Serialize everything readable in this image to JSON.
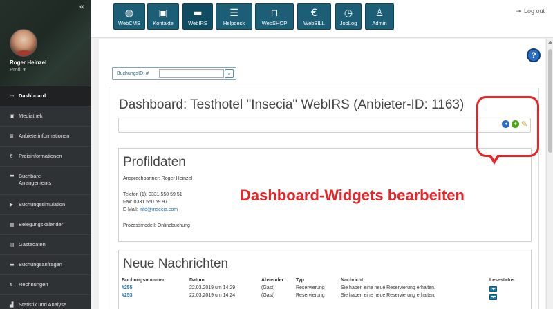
{
  "sidebar": {
    "collapse_icon": "double-chevron-left-icon",
    "user_name": "Roger Heinzel",
    "profile_label": "Profil ▾",
    "items": [
      {
        "label": "Dashboard",
        "icon": "monitor-icon",
        "glyph": "▭"
      },
      {
        "label": "Mediathek",
        "icon": "image-icon",
        "glyph": "▣"
      },
      {
        "label": "Anbieterinformationen",
        "icon": "list-icon",
        "glyph": "≣"
      },
      {
        "label": "Preisinformationen",
        "icon": "euro-icon",
        "glyph": "€"
      },
      {
        "label": "Buchbare Arrangements",
        "icon": "bed-icon",
        "glyph": "▬"
      },
      {
        "label": "Buchungssimulation",
        "icon": "play-icon",
        "glyph": "▶"
      },
      {
        "label": "Belegungskalender",
        "icon": "calendar-icon",
        "glyph": "▦"
      },
      {
        "label": "Gästedaten",
        "icon": "user-card-icon",
        "glyph": "▤"
      },
      {
        "label": "Buchungsanfragen",
        "icon": "bed-icon",
        "glyph": "▬"
      },
      {
        "label": "Rechnungen",
        "icon": "euro-icon",
        "glyph": "€"
      },
      {
        "label": "Statistik und Analyse",
        "icon": "chart-icon",
        "glyph": "▟"
      }
    ]
  },
  "nav": [
    {
      "label": "WebCMS",
      "glyph": "◍"
    },
    {
      "label": "Kontakte",
      "glyph": "▣"
    },
    {
      "label": "WebIRS",
      "glyph": "▬"
    },
    {
      "label": "Helpdesk",
      "glyph": "☰"
    },
    {
      "label": "WebSHOP",
      "glyph": "⊓"
    },
    {
      "label": "WebBILL",
      "glyph": "€"
    },
    {
      "label": "JobLog",
      "glyph": "◷"
    },
    {
      "label": "Admin",
      "glyph": "♙"
    }
  ],
  "header": {
    "logout_label": "Log out",
    "help_label": "?"
  },
  "search": {
    "label": "BuchungsID: #",
    "value": ""
  },
  "dashboard": {
    "title": "Dashboard: Testhotel \"Insecia\" WebIRS (Anbieter-ID: 1163)"
  },
  "annotation": "Dashboard-Widgets bearbeiten",
  "profil": {
    "title": "Profildaten",
    "contact": "Ansprechpartner: Roger Heinzel",
    "phone": "Telefon (1): 0331 550 59 51",
    "fax": "Fax: 0331 550 59 97",
    "email_label": "E-Mail:",
    "email": "info@insecia.com",
    "process": "Prozessmodell: Onlinebuchung"
  },
  "messages": {
    "title": "Neue Nachrichten",
    "headers": [
      "Buchungsnummer",
      "Datum",
      "Absender",
      "Typ",
      "Nachricht",
      "Lesestatus"
    ],
    "rows": [
      {
        "id": "#255",
        "date": "22.03.2019 um 14:29",
        "sender": "(Gast)",
        "type": "Reservierung",
        "text": "Sie haben eine neue Reservierung erhalten."
      },
      {
        "id": "#253",
        "date": "22.03.2019 um 14:24",
        "sender": "(Gast)",
        "type": "Reservierung",
        "text": "Sie haben eine neue Reservierung erhalten."
      }
    ]
  },
  "colors": {
    "accent": "#1b5e76",
    "highlight": "#e52528",
    "link": "#1c6fa8"
  }
}
